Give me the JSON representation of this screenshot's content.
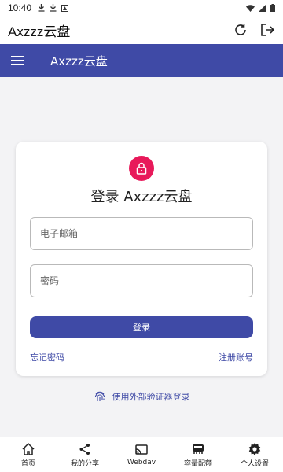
{
  "status_bar": {
    "time": "10:40"
  },
  "app_bar": {
    "title": "Axzzz云盘"
  },
  "toolbar": {
    "title": "Axzzz云盘"
  },
  "login_card": {
    "title": "登录 Axzzz云盘",
    "email_placeholder": "电子邮箱",
    "password_placeholder": "密码",
    "login_button": "登录",
    "forgot_password": "忘记密码",
    "register": "注册账号"
  },
  "external_login": {
    "label": "使用外部验证器登录"
  },
  "bottom_nav": {
    "items": [
      {
        "label": "首页",
        "icon": "home-icon"
      },
      {
        "label": "我的分享",
        "icon": "share-icon"
      },
      {
        "label": "Webdav",
        "icon": "cast-icon"
      },
      {
        "label": "容量配额",
        "icon": "storage-icon"
      },
      {
        "label": "个人设置",
        "icon": "gear-icon"
      }
    ]
  },
  "colors": {
    "primary": "#3f4aa6",
    "lock_badge": "#e8195a",
    "background": "#f3f3f5"
  }
}
